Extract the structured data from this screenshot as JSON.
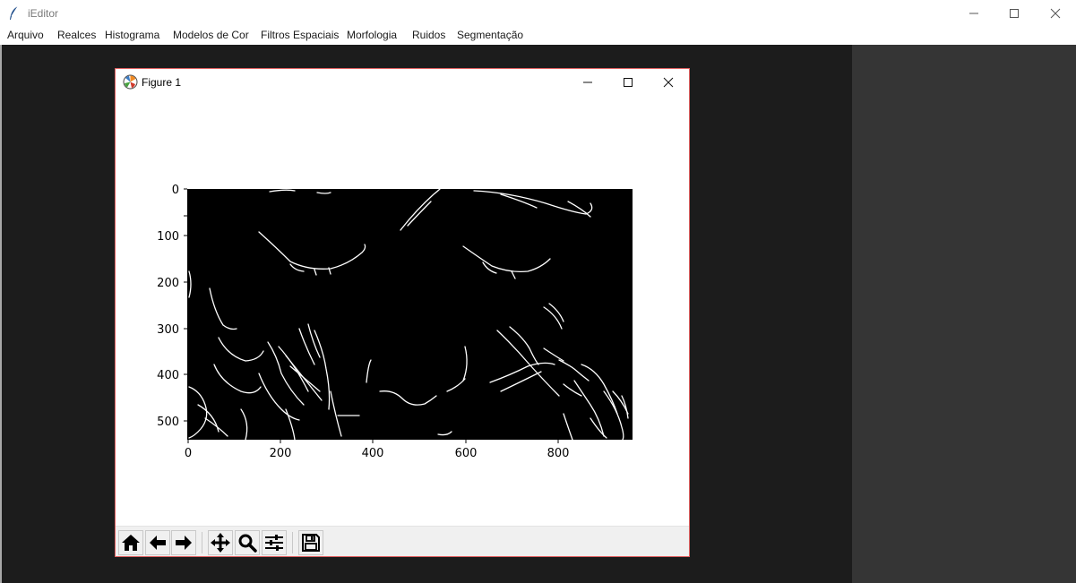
{
  "app": {
    "title": "iEditor",
    "icon": "feather-icon"
  },
  "menu": {
    "items": [
      "Arquivo",
      "Realces",
      "Histograma",
      "Modelos de Cor",
      "Filtros Espaciais",
      "Morfologia",
      "Ruidos",
      "Segmentação"
    ]
  },
  "figure": {
    "title": "Figure 1",
    "icon": "matplotlib-logo-icon",
    "image_description": "binary edge-detection result (white edges on black) of a face with butterfly wings",
    "x_ticks": [
      "0",
      "200",
      "400",
      "600",
      "800"
    ],
    "y_ticks": [
      "0",
      "100",
      "200",
      "300",
      "400",
      "500"
    ],
    "x_range": [
      0,
      960
    ],
    "y_range": [
      0,
      540
    ]
  },
  "toolbar": {
    "buttons": [
      "home-icon",
      "back-icon",
      "forward-icon",
      "pan-icon",
      "zoom-icon",
      "configure-subplots-icon",
      "save-icon"
    ]
  },
  "colors": {
    "workspace": "#1c1c1c",
    "side_panel": "#353535",
    "figure_border": "#e06060",
    "toolbar_bg": "#f0f0f0",
    "image_bg": "#000000",
    "edges": "#ffffff"
  }
}
